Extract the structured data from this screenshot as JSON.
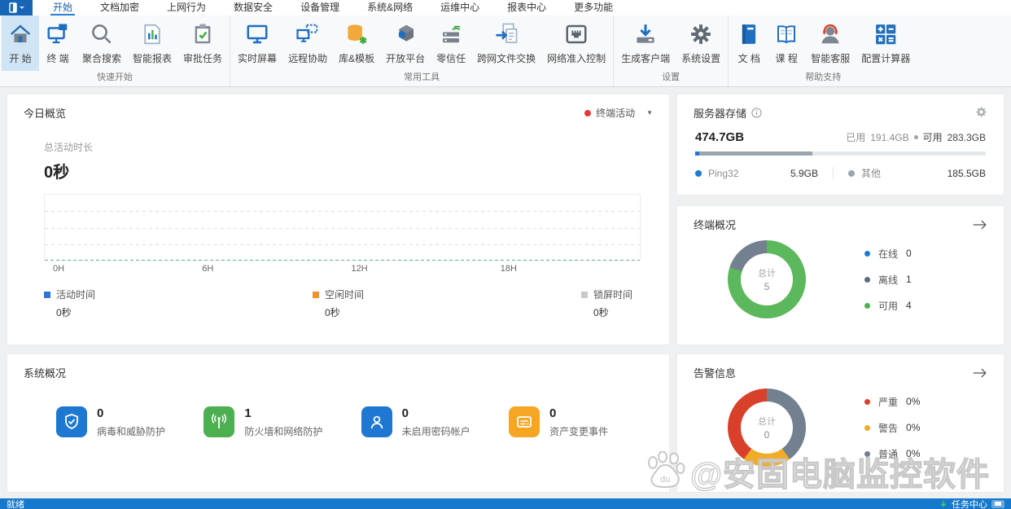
{
  "menu": {
    "tabs": [
      {
        "label": "开始",
        "active": true
      },
      {
        "label": "文档加密"
      },
      {
        "label": "上网行为"
      },
      {
        "label": "数据安全"
      },
      {
        "label": "设备管理"
      },
      {
        "label": "系统&网络"
      },
      {
        "label": "运维中心"
      },
      {
        "label": "报表中心"
      },
      {
        "label": "更多功能"
      }
    ]
  },
  "ribbon": {
    "groups": [
      {
        "label": "快速开始",
        "items": [
          {
            "label": "开 始"
          },
          {
            "label": "终 端"
          },
          {
            "label": "聚合搜索"
          },
          {
            "label": "智能报表"
          },
          {
            "label": "审批任务"
          }
        ]
      },
      {
        "label": "常用工具",
        "items": [
          {
            "label": "实时屏幕"
          },
          {
            "label": "远程协助"
          },
          {
            "label": "库&模板"
          },
          {
            "label": "开放平台"
          },
          {
            "label": "零信任"
          },
          {
            "label": "跨网文件交换"
          },
          {
            "label": "网络准入控制"
          }
        ]
      },
      {
        "label": "设置",
        "items": [
          {
            "label": "生成客户端"
          },
          {
            "label": "系统设置"
          }
        ]
      },
      {
        "label": "帮助支持",
        "items": [
          {
            "label": "文 档"
          },
          {
            "label": "课 程"
          },
          {
            "label": "智能客服"
          },
          {
            "label": "配置计算器"
          }
        ]
      }
    ]
  },
  "today": {
    "title": "今日概览",
    "filter_label": "终端活动",
    "filter_dot_color": "#e23c39",
    "metric_label": "总活动时长",
    "metric_value": "0秒",
    "ticks": [
      "0H",
      "6H",
      "12H",
      "18H"
    ],
    "legend": [
      {
        "label": "活动时间",
        "value": "0秒",
        "color": "#2e75d4"
      },
      {
        "label": "空闲时间",
        "value": "0秒",
        "color": "#f0922b"
      },
      {
        "label": "锁屏时间",
        "value": "0秒",
        "color": "#c9c9c9"
      }
    ]
  },
  "storage": {
    "title": "服务器存储",
    "total": "474.7GB",
    "used_label": "已用",
    "used_value": "191.4GB",
    "free_label": "可用",
    "free_value": "283.3GB",
    "bar_segments": [
      {
        "color": "#1e78d2",
        "pct": 1.5
      },
      {
        "color": "#9aa5ae",
        "pct": 38.8
      },
      {
        "color": "#e4e7ea",
        "pct": 59.7
      }
    ],
    "items": [
      {
        "label": "Ping32",
        "value": "5.9GB",
        "color": "#1e78d2"
      },
      {
        "label": "其他",
        "value": "185.5GB",
        "color": "#9aa5ae"
      }
    ]
  },
  "terminals": {
    "title": "终端概况",
    "center_label": "总计",
    "center_value": "5",
    "segments": [
      {
        "color": "#5cb85c",
        "pct": 80
      },
      {
        "color": "#72808f",
        "pct": 20
      }
    ],
    "legend": [
      {
        "label": "在线",
        "value": "0",
        "color": "#1e78d2"
      },
      {
        "label": "离线",
        "value": "1",
        "color": "#5a6b7d"
      },
      {
        "label": "可用",
        "value": "4",
        "color": "#4caf50"
      }
    ]
  },
  "system": {
    "title": "系统概况",
    "items": [
      {
        "value": "0",
        "label": "病毒和威胁防护",
        "color": "#1e78d2"
      },
      {
        "value": "1",
        "label": "防火墙和网络防护",
        "color": "#4caf50"
      },
      {
        "value": "0",
        "label": "未启用密码帐户",
        "color": "#1e78d2"
      },
      {
        "value": "0",
        "label": "资产变更事件",
        "color": "#f5a623"
      }
    ]
  },
  "alerts": {
    "title": "告警信息",
    "center_label": "总计",
    "center_value": "0",
    "segments": [
      {
        "color": "#72808f",
        "pct": 40
      },
      {
        "color": "#f0ab27",
        "pct": 20
      },
      {
        "color": "#d9402a",
        "pct": 40
      }
    ],
    "legend": [
      {
        "label": "严重",
        "value": "0%",
        "color": "#d9402a"
      },
      {
        "label": "警告",
        "value": "0%",
        "color": "#f0ab27"
      },
      {
        "label": "普通",
        "value": "0%",
        "color": "#72808f"
      }
    ]
  },
  "watermark": {
    "badge": "du",
    "text": "@安固电脑监控软件"
  },
  "statusbar": {
    "ready": "就绪",
    "task_center": "任务中心"
  },
  "chart_data": [
    {
      "type": "line",
      "title": "今日概览 - 终端活动",
      "x_ticks": [
        "0H",
        "6H",
        "12H",
        "18H"
      ],
      "x_range_hours": [
        0,
        24
      ],
      "series": [
        {
          "name": "活动时间",
          "values_seconds": 0,
          "color": "#2e75d4"
        },
        {
          "name": "空闲时间",
          "values_seconds": 0,
          "color": "#f0922b"
        },
        {
          "name": "锁屏时间",
          "values_seconds": 0,
          "color": "#c9c9c9"
        }
      ],
      "grid": "horizontal-dashed",
      "note": "all series zero / empty plot"
    },
    {
      "type": "pie",
      "title": "终端概况",
      "labels": [
        "在线",
        "离线",
        "可用"
      ],
      "values": [
        0,
        1,
        4
      ],
      "total": 5,
      "colors": [
        "#1e78d2",
        "#5a6b7d",
        "#4caf50"
      ],
      "legend_position": "right"
    },
    {
      "type": "pie",
      "title": "告警信息",
      "labels": [
        "严重",
        "警告",
        "普通"
      ],
      "values": [
        "0%",
        "0%",
        "0%"
      ],
      "total": 0,
      "colors": [
        "#d9402a",
        "#f0ab27",
        "#72808f"
      ],
      "legend_position": "right"
    }
  ]
}
